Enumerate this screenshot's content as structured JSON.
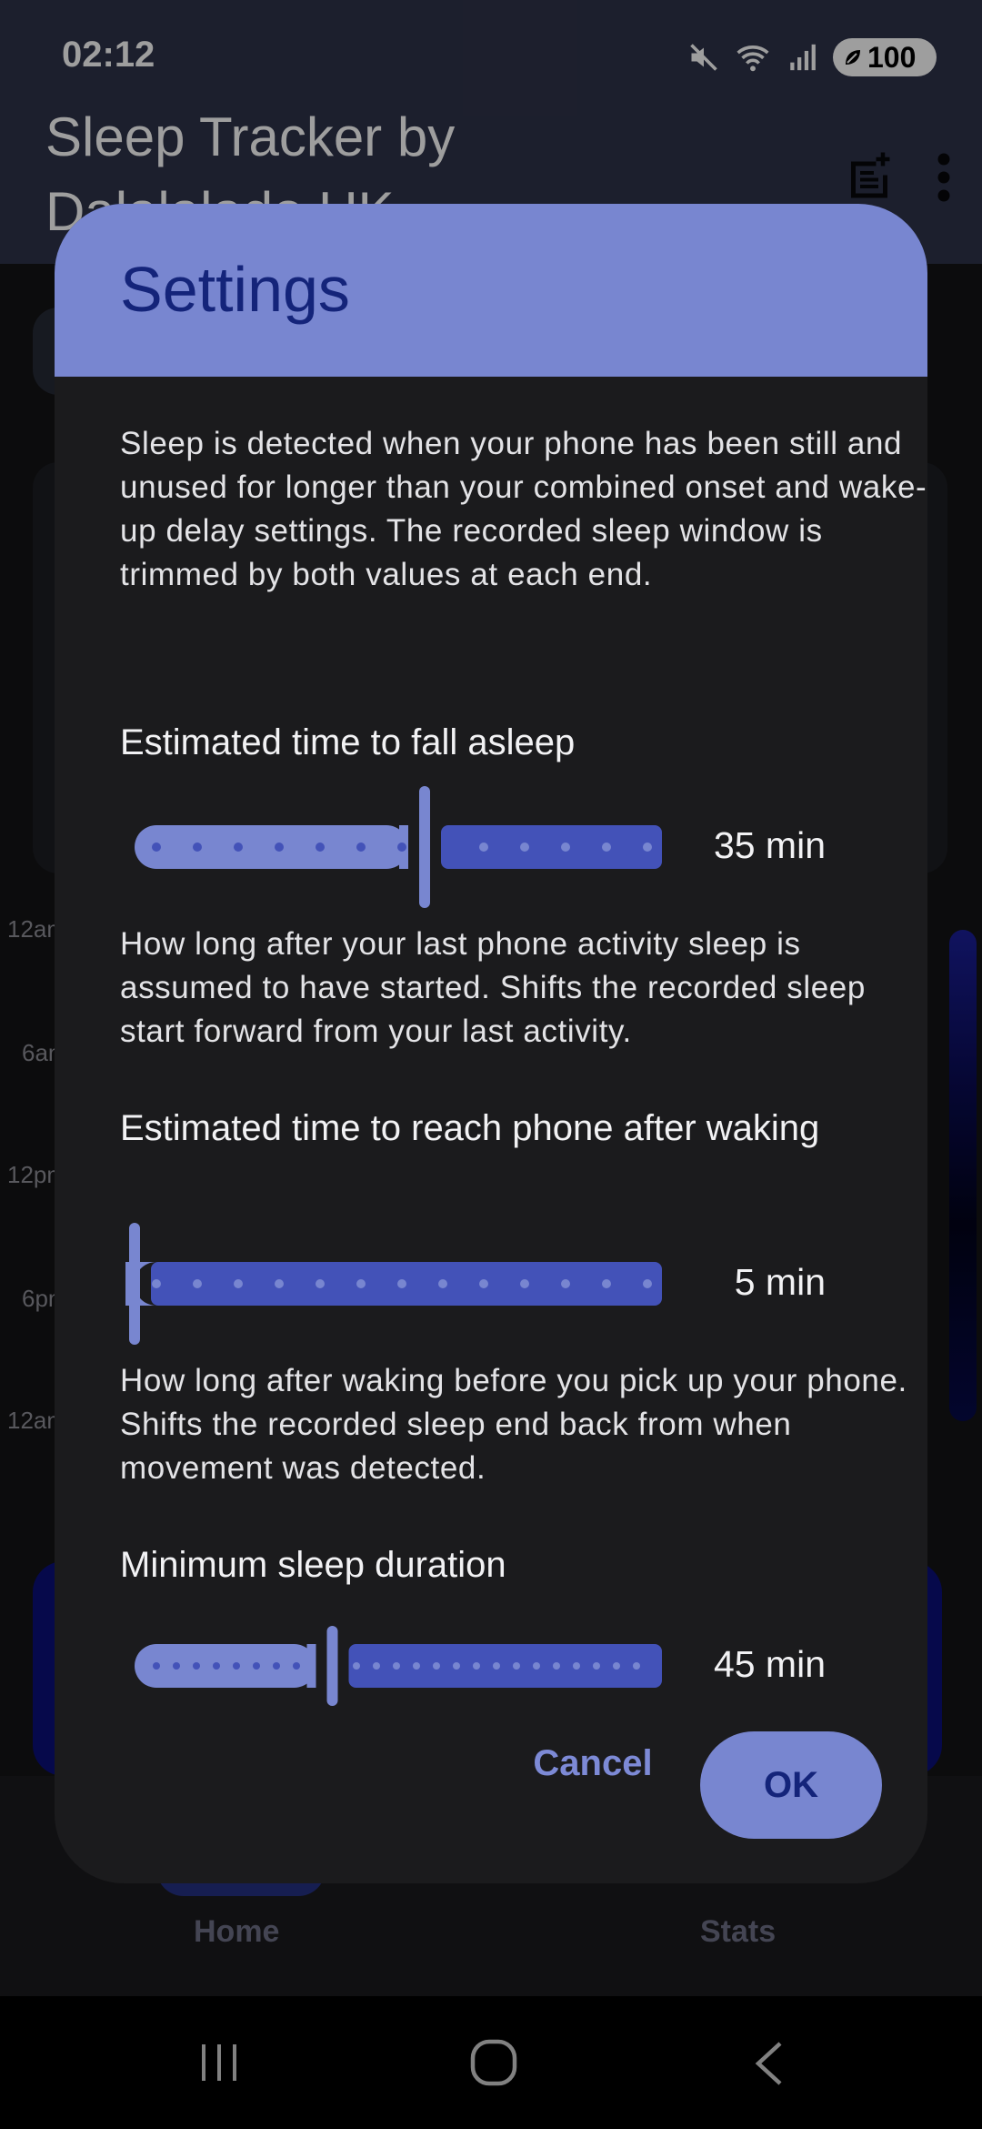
{
  "status_bar": {
    "time": "02:12",
    "battery": "100",
    "icons": [
      "mute-icon",
      "wifi-icon",
      "signal-icon",
      "battery-icon"
    ]
  },
  "app": {
    "title": "Sleep Tracker by Dalalalado UK",
    "actions": [
      "add-note-icon",
      "more-vert-icon"
    ],
    "hour_labels": [
      "12am",
      "6am",
      "12pm",
      "6pm",
      "12am"
    ],
    "nav": {
      "home": "Home",
      "stats": "Stats"
    }
  },
  "dialog": {
    "title": "Settings",
    "intro": "Sleep is detected when your phone has been still and unused for longer than your combined onset and wake-up delay settings. The recorded sleep window is trimmed by both values at each end.",
    "settings": [
      {
        "label": "Estimated time to fall asleep",
        "value_text": "35 min",
        "fraction": 0.55,
        "description": "How long after your last phone activity sleep is assumed to have started. Shifts the recorded sleep start forward from your last activity."
      },
      {
        "label": "Estimated time to reach phone after waking",
        "value_text": "5 min",
        "fraction": 0.0,
        "description": "How long after waking before you pick up your phone. Shifts the recorded sleep end back from when movement was detected."
      },
      {
        "label": "Minimum sleep duration",
        "value_text": "45 min",
        "fraction": 0.375,
        "description": ""
      }
    ],
    "cancel_label": "Cancel",
    "ok_label": "OK"
  },
  "colors": {
    "accent": "#7886d0",
    "accent_dark": "#14247a",
    "slider_active": "#7886d0",
    "slider_inactive": "#4352b8"
  }
}
